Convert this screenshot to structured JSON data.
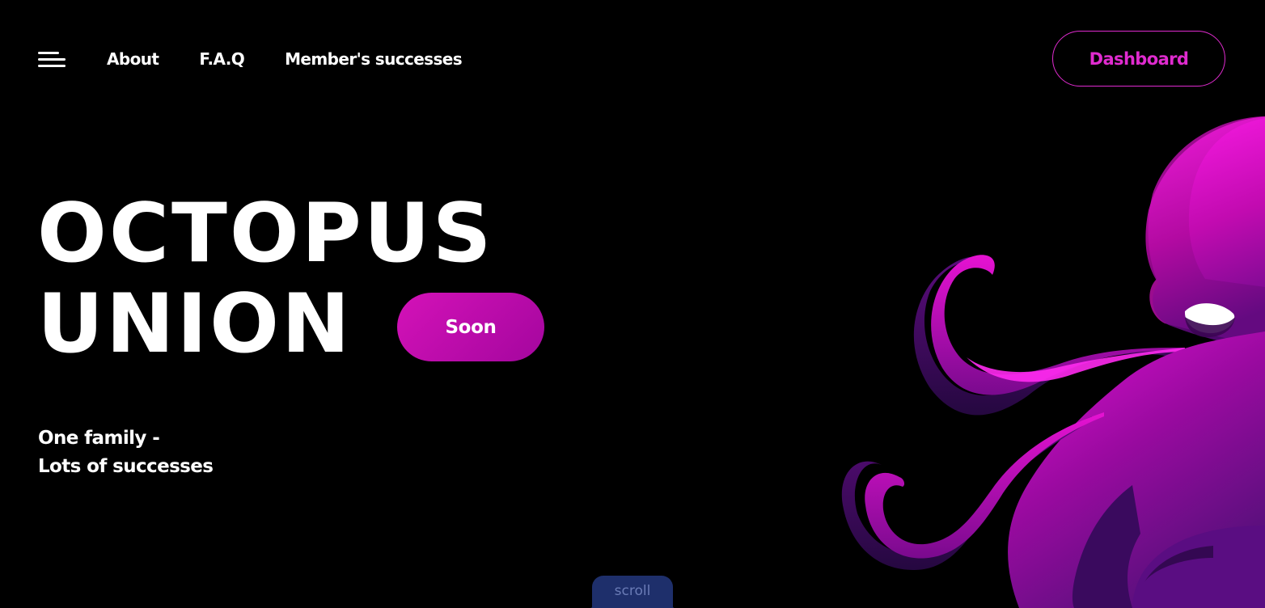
{
  "header": {
    "nav_items": [
      {
        "label": "About"
      },
      {
        "label": "F.A.Q"
      },
      {
        "label": "Member's successes"
      }
    ],
    "dashboard_label": "Dashboard"
  },
  "hero": {
    "title_line1": "OCTOPUS",
    "title_line2": "UNION",
    "badge": "Soon",
    "tagline_line1": "One family -",
    "tagline_line2": "Lots of successes"
  },
  "scroll_label": "scroll",
  "icons": {
    "menu": "hamburger-menu-icon",
    "mascot": "octopus-illustration"
  },
  "colors": {
    "background": "#000000",
    "accent": "#e02bcf",
    "badge_gradient_start": "#d412b8",
    "badge_gradient_end": "#a4069e",
    "octopus_light": "#ff1ee8",
    "octopus_dark": "#4a0a6e",
    "scroll_tab": "#1e2f6b"
  }
}
